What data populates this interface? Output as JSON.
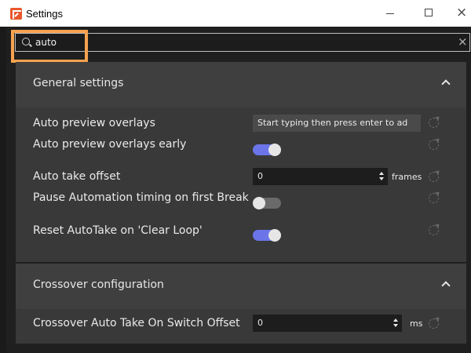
{
  "window": {
    "title": "Settings",
    "controls": {
      "minimize": "minimize",
      "maximize": "maximize",
      "close": "×"
    }
  },
  "search": {
    "value": "auto",
    "clear": "×"
  },
  "general": {
    "title": "General settings",
    "rows": [
      {
        "label": "Auto preview overlays",
        "control": "text",
        "placeholder": "Start typing then press enter to ad"
      },
      {
        "label": "Auto preview overlays early",
        "control": "toggle",
        "state": "on"
      },
      {
        "label": "Auto take offset",
        "control": "number",
        "value": "0",
        "unit": "frames"
      },
      {
        "label": "Pause Automation timing on first Break",
        "control": "toggle",
        "state": "off"
      },
      {
        "label": "Reset AutoTake on 'Clear Loop'",
        "control": "toggle",
        "state": "on"
      }
    ]
  },
  "crossover": {
    "title": "Crossover configuration",
    "rows": [
      {
        "label": "Crossover Auto Take On Switch Offset",
        "control": "number",
        "value": "0",
        "unit": "ms"
      }
    ]
  },
  "colors": {
    "accent": "#6b75e8",
    "highlight": "#f6a24f",
    "app_icon": "#e8572c",
    "background": "#202020",
    "panel": "#393939"
  }
}
